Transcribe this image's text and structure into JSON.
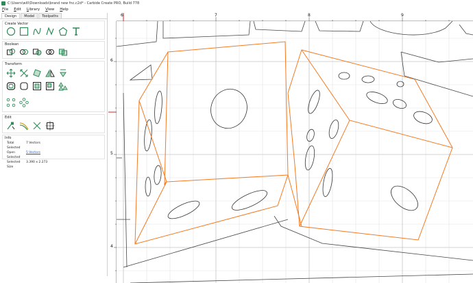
{
  "window": {
    "title": "C:\\Users\\will\\Downloads\\brand new fnc.c2d* - Carbide Create PRO, Build 778"
  },
  "menu": {
    "file": "File",
    "edit": "Edit",
    "library": "Library",
    "view": "View",
    "help": "Help"
  },
  "tabs": [
    {
      "label": "Design"
    },
    {
      "label": "Model"
    },
    {
      "label": "Toolpaths"
    }
  ],
  "sections": {
    "create_vector": "Create Vector",
    "boolean": "Boolean",
    "transform": "Transform",
    "edit": "Edit",
    "info": "Info"
  },
  "icons": {
    "create_vector": [
      "circle-icon",
      "rectangle-icon",
      "curve-icon",
      "polyline-icon",
      "polygon-icon",
      "text-icon"
    ],
    "boolean": [
      "join-icon",
      "union-icon",
      "subtract-icon",
      "intersect-icon",
      "weld-icon"
    ],
    "transform_row1": [
      "move-icon",
      "scale-icon",
      "rotate-icon",
      "mirror-icon",
      "align-icon"
    ],
    "transform_row2": [
      "offset-icon",
      "fillet-icon",
      "inset-icon",
      "group-icon",
      "array-icon"
    ],
    "transform_row3": [
      "circular-array-icon",
      "rectangular-array-icon"
    ],
    "edit": [
      "node-edit-icon",
      "trim-icon",
      "cut-icon",
      "bounding-box-icon"
    ]
  },
  "info": {
    "total_selected_label": "Total Selected",
    "total_selected_value": "7 Vectors",
    "open_selected_label": "Open Selected",
    "open_selected_value": "5 Vectors",
    "selected_size_label": "Selected Size",
    "selected_size_value": "3.390 x 2.273"
  },
  "rulers": {
    "top": [
      "6",
      "7",
      "8",
      "9"
    ],
    "left": [
      "6",
      "5",
      "4"
    ]
  },
  "colors": {
    "selection": "#f47a20",
    "ruler_marker": "#d32020",
    "panel_icon": "#2e8b57"
  }
}
